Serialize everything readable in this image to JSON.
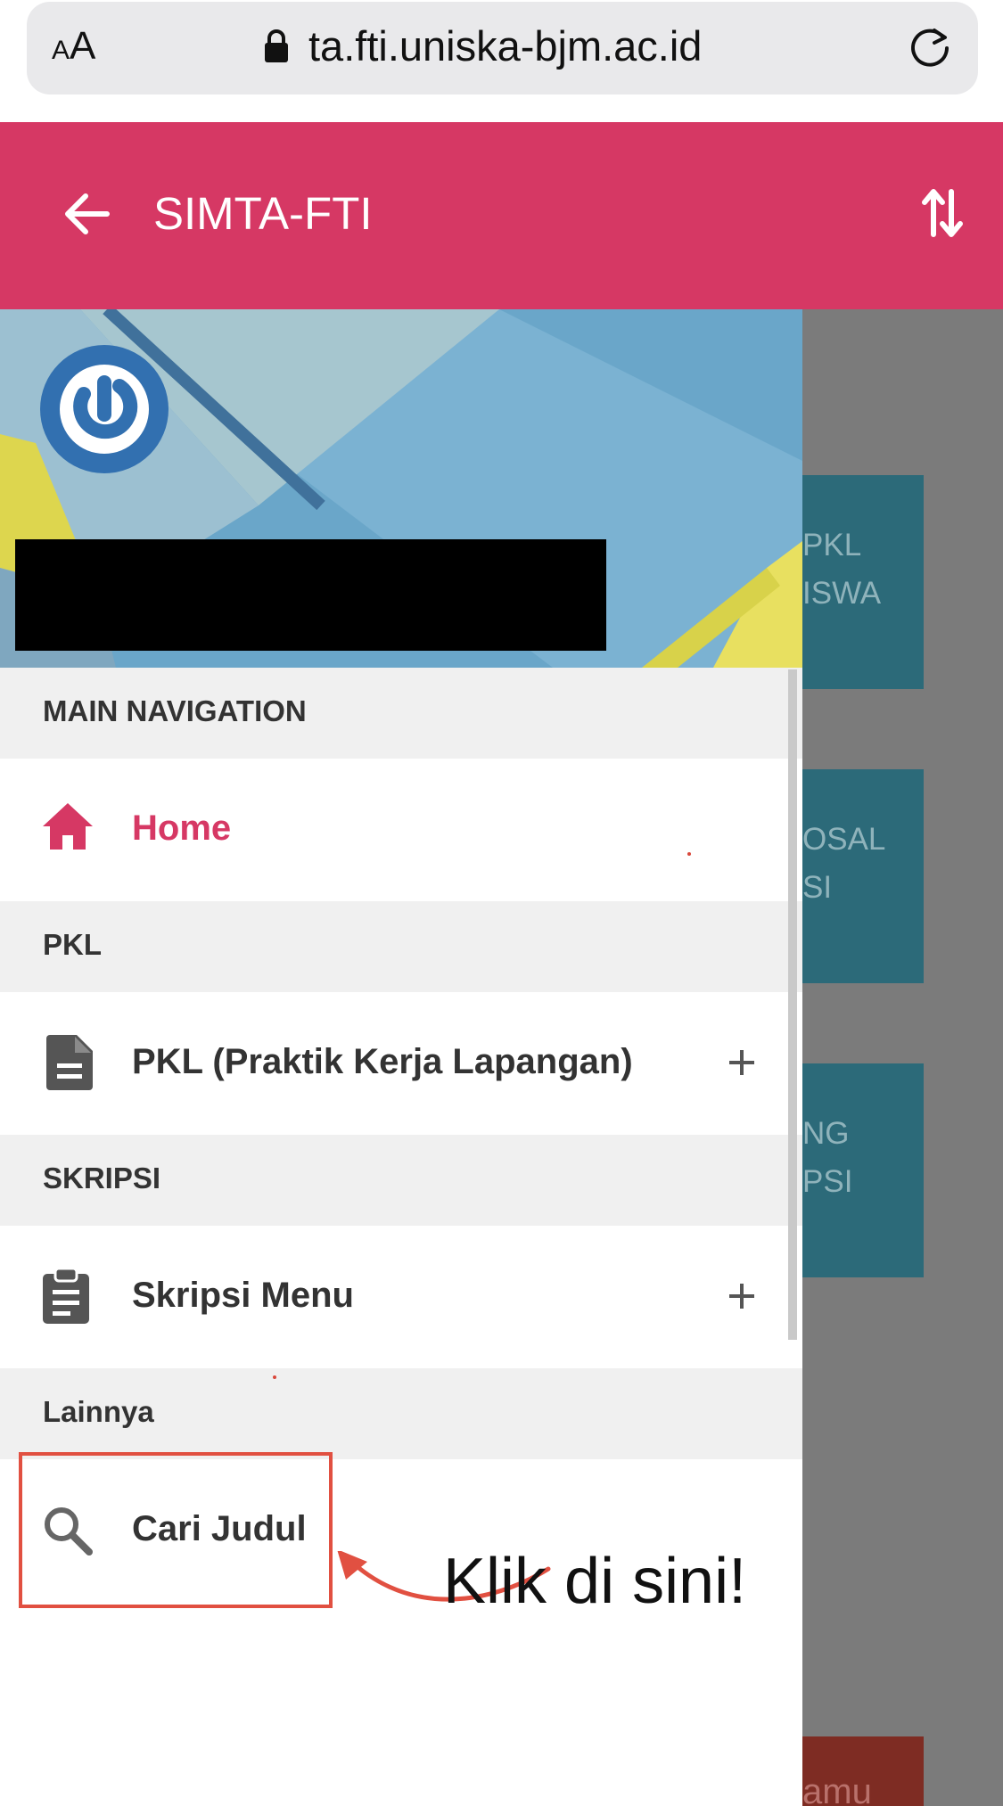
{
  "browser": {
    "text_size_label": "AA",
    "url": "ta.fti.uniska-bjm.ac.id"
  },
  "app": {
    "title": "SIMTA-FTI"
  },
  "background_page": {
    "cards": [
      {
        "line1": "PKL",
        "line2": "ISWA"
      },
      {
        "line1": "OSAL",
        "line2": "SI"
      },
      {
        "line1": "NG",
        "line2": "PSI"
      }
    ],
    "bottom_text": "amu"
  },
  "drawer": {
    "sections": [
      {
        "header": "MAIN NAVIGATION",
        "item": {
          "label": "Home",
          "icon": "home-icon",
          "active": true
        }
      },
      {
        "header": "PKL",
        "item": {
          "label": "PKL (Praktik Kerja Lapangan)",
          "icon": "document-icon",
          "expandable": true
        }
      },
      {
        "header": "SKRIPSI",
        "item": {
          "label": "Skripsi Menu",
          "icon": "clipboard-icon",
          "expandable": true
        }
      },
      {
        "header": "Lainnya",
        "item": {
          "label": "Cari Judul",
          "icon": "search-icon"
        }
      }
    ]
  },
  "annotation": {
    "text": "Klik di sini!"
  },
  "colors": {
    "header": "#d63864",
    "active_item": "#d63864",
    "section_bg": "#f0f0f0",
    "annotation": "#e15041",
    "card": "#2c6a79"
  }
}
